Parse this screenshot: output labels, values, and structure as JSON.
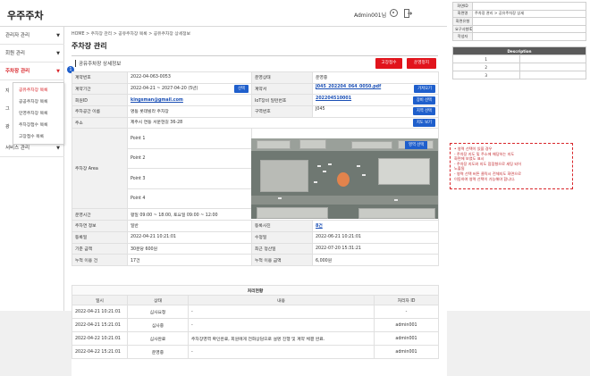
{
  "header": {
    "logo": "우주주차",
    "admin": "Admin001님"
  },
  "sidebar": {
    "items": [
      {
        "label": "관리자 관리",
        "arrow": "▼"
      },
      {
        "label": "회원 관리",
        "arrow": "▼"
      },
      {
        "label": "주차장 관리",
        "arrow": "▼"
      },
      {
        "label": "서비스 관리",
        "arrow": "▼"
      }
    ],
    "letters": [
      "지",
      "그",
      "광"
    ],
    "submenu": [
      "공유주차장 목록",
      "공공주차장 목록",
      "민영주차장 목록",
      "주차장접수 목록",
      "고장접수 목록"
    ]
  },
  "page": {
    "breadcrumb": "HOME > 주차장 관리 > 공유주차장 목록 > 공유주차장 상세정보",
    "title": "주차장 관리",
    "section": "공유주차장 상세정보",
    "badge": "1",
    "buttons": {
      "repair": "고장접수",
      "stop": "운영정지"
    }
  },
  "info": {
    "contract_no_label": "계약번호",
    "contract_no": "2022-04-063-0053",
    "status_label": "운영상태",
    "status": "운영중",
    "period_label": "계약기간",
    "period": "2022-04-21 ~ 2027-04-20 (5년)",
    "period_btn": "선택",
    "contract_label": "계약서",
    "contract_file": "J045_202204_064_0050.pdf",
    "contract_btn": "가져오기",
    "member_label": "회원ID",
    "member": "kingsman@gmail.com",
    "iot_label": "IoT장비 일련번호",
    "iot": "202204510001",
    "iot_btn": "장비 선택",
    "lot_name_label": "주차공간 이름",
    "lot_name": "명동 롯데빌라 주차장",
    "zone_label": "구역번호",
    "zone": "J045",
    "zone_btn": "지역 선택",
    "address_label": "주소",
    "address": "제주시 연동 서문현길 36-28",
    "address_btn": "지도 보기",
    "area_label": "주차장 Area",
    "points": [
      "Point 1",
      "Point 2",
      "Point 3",
      "Point 4"
    ],
    "map_btn": "영역 선택",
    "hours_label": "운영시간",
    "hours": "평일 09:00 ~ 18:00, 토요일 09:00 ~ 12:00",
    "basis_label": "주차면 정보",
    "basis": "일반",
    "photo_label": "등록사진",
    "photo": "8건",
    "reg_label": "등록일",
    "reg": "2022-04-21 10:21:01",
    "mod_label": "수정일",
    "mod": "2022-06-21 10:21:01",
    "fee_label": "기준 금액",
    "fee": "30분당 600원",
    "settle_label": "최근 정산일",
    "settle": "2022-07-20 15:31:21",
    "uses_label": "누적 이용 건",
    "uses": "17건",
    "amount_label": "누적 이용 금액",
    "amount": "6,000원"
  },
  "process": {
    "caption": "처리현황",
    "headers": [
      "일시",
      "상태",
      "내용",
      "처리자 ID"
    ],
    "rows": [
      [
        "2022-04-21 10:21:01",
        "심사요청",
        "-",
        "-"
      ],
      [
        "2022-04-21 15:21:01",
        "심사중",
        "-",
        "admin001"
      ],
      [
        "2022-04-22 10:21:01",
        "심사완료",
        "주차장영역 확인완료, 회원에게 전화상담으로 설명 진행 및 계약 체결 완료.",
        "admin001"
      ],
      [
        "2022-04-22 15:21:01",
        "운영중",
        "-",
        "admin001"
      ]
    ]
  },
  "meta": {
    "rows": [
      [
        "화면ID",
        ""
      ],
      [
        "화면명",
        "주차장 관리 > 공유주차장 상세"
      ],
      [
        "화면유형",
        ""
      ],
      [
        "요구사항ID",
        ""
      ],
      [
        "작성자",
        ""
      ]
    ],
    "desc_header": "Description",
    "desc_rows": [
      "1",
      "2",
      "3"
    ]
  },
  "note": {
    "lines": [
      "• 영역 선택이 있을 경우",
      "  - 주차장 지도 및 주소에 해당하는 지도",
      "    화면에 보였도 표시",
      "  - 주차장 지도와 지도 점점형으로 세팅 되어",
      "    노출됨",
      "  - 영역 선택 버튼 클릭시 전체지도 화면으로",
      "    이동하여 영역 선택이 가능해야 합니다."
    ]
  },
  "colors": {
    "accent_red": "#e1141c",
    "accent_blue": "#1f5fcc",
    "link": "#1a4fb5"
  }
}
